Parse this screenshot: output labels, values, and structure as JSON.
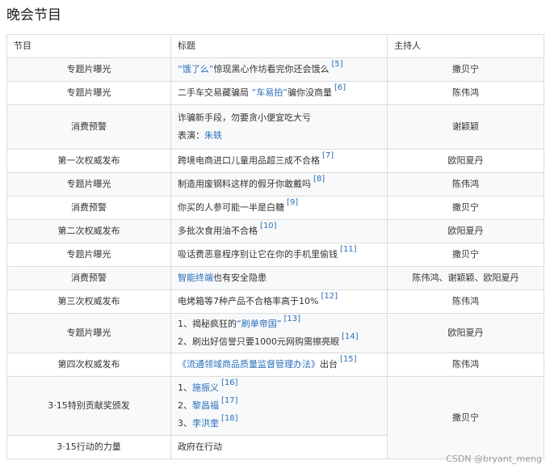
{
  "heading": "晚会节目",
  "columns": [
    "节目",
    "标题",
    "主持人"
  ],
  "rows": [
    {
      "program": "专题片曝光",
      "title_pre": "",
      "title_link": "“饿了么”",
      "title_post": "惊现黑心作坊看完你还会饿么",
      "cite": "[5]",
      "host": "撒贝宁"
    },
    {
      "program": "专题片曝光",
      "title_pre": "二手车交易藏骗局 ",
      "title_link": "“车易拍”",
      "title_post": "骗你没商量",
      "cite": "[6]",
      "host": "陈伟鸿"
    },
    {
      "program": "消费预警",
      "title_line1": "诈骗新手段，勿要贪小便宜吃大亏",
      "title_line2_pre": "表演：",
      "title_line2_link": "朱轶",
      "host": "谢颖颖"
    },
    {
      "program": "第一次权威发布",
      "title": "跨境电商进口儿童用品超三成不合格",
      "cite": "[7]",
      "host": "欧阳夏丹"
    },
    {
      "program": "专题片曝光",
      "title": "制造用废钢料这样的假牙你敢戴吗",
      "cite": "[8]",
      "host": "陈伟鸿"
    },
    {
      "program": "消费预警",
      "title": "你买的人参可能一半是白糖",
      "cite": "[9]",
      "host": "撒贝宁"
    },
    {
      "program": "第二次权威发布",
      "title": "多批次食用油不合格",
      "cite": "[10]",
      "host": "欧阳夏丹"
    },
    {
      "program": "专题片曝光",
      "title": "吸话费恶意程序别让它在你的手机里偷钱",
      "cite": "[11]",
      "host": "撒贝宁"
    },
    {
      "program": "消费预警",
      "title_link": "智能终端",
      "title_post": "也有安全隐患",
      "host": "陈伟鸿、谢颖颖、欧阳夏丹"
    },
    {
      "program": "第三次权威发布",
      "title": "电烤箱等7种产品不合格率高于10%",
      "cite": "[12]",
      "host": "陈伟鸿"
    },
    {
      "program": "专题片曝光",
      "line1_pre": "1、揭秘疯狂的",
      "line1_link": "“刷单帝国”",
      "cite1": "[13]",
      "line2": "2、刷出好信誉只要1000元网购需擦亮眼",
      "cite2": "[14]",
      "host": "欧阳夏丹"
    },
    {
      "program": "第四次权威发布",
      "title_link": "《流通领域商品质量监督管理办法》",
      "title_post": "出台",
      "cite": "[15]",
      "host": "陈伟鸿"
    },
    {
      "program": "3·15特别贡献奖颁发",
      "l1_pre": "1、",
      "l1_link": "施振义",
      "c1": "[16]",
      "l2_pre": "2、",
      "l2_link": "黎昌福",
      "c2": "[17]",
      "l3_pre": "3、",
      "l3_link": "李洪奎",
      "c3": "[18]",
      "host": "撒贝宁"
    },
    {
      "program": "3·15行动的力量",
      "title": "政府在行动"
    }
  ],
  "watermark": "CSDN @bryant_meng"
}
